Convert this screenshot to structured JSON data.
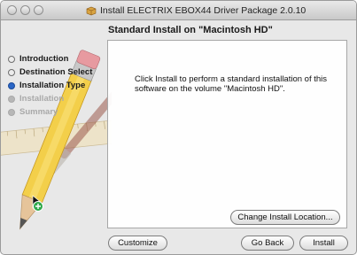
{
  "window": {
    "title": "Install ELECTRIX EBOX44 Driver Package 2.0.10"
  },
  "header": {
    "panel_title": "Standard Install on \"Macintosh HD\""
  },
  "sidebar": {
    "steps": [
      {
        "label": "Introduction",
        "state": "done"
      },
      {
        "label": "Destination Select",
        "state": "done"
      },
      {
        "label": "Installation Type",
        "state": "current"
      },
      {
        "label": "Installation",
        "state": "todo"
      },
      {
        "label": "Summary",
        "state": "todo"
      }
    ]
  },
  "main": {
    "message": "Click Install to perform a standard installation of this software on the volume \"Macintosh HD\"."
  },
  "buttons": {
    "change_location": "Change Install Location...",
    "customize": "Customize",
    "go_back": "Go Back",
    "install": "Install"
  },
  "colors": {
    "current_step": "#2a66c7",
    "pending_step": "#a9a9a9"
  }
}
